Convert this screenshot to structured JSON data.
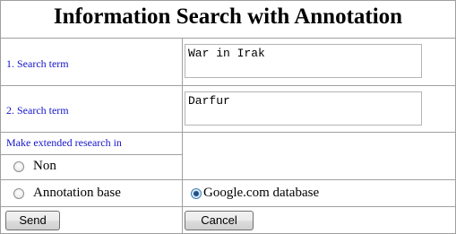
{
  "title": "Information Search with Annotation",
  "search_term_1": {
    "label": "1. Search term",
    "value": "War in Irak"
  },
  "search_term_2": {
    "label": "2. Search term",
    "value": "Darfur"
  },
  "extended_research": {
    "label": "Make extended research in",
    "options": [
      {
        "label": "Non",
        "checked": false
      },
      {
        "label": "Annotation base",
        "checked": false
      },
      {
        "label": "Google.com database",
        "checked": true
      }
    ]
  },
  "buttons": {
    "send": "Send",
    "cancel": "Cancel"
  }
}
